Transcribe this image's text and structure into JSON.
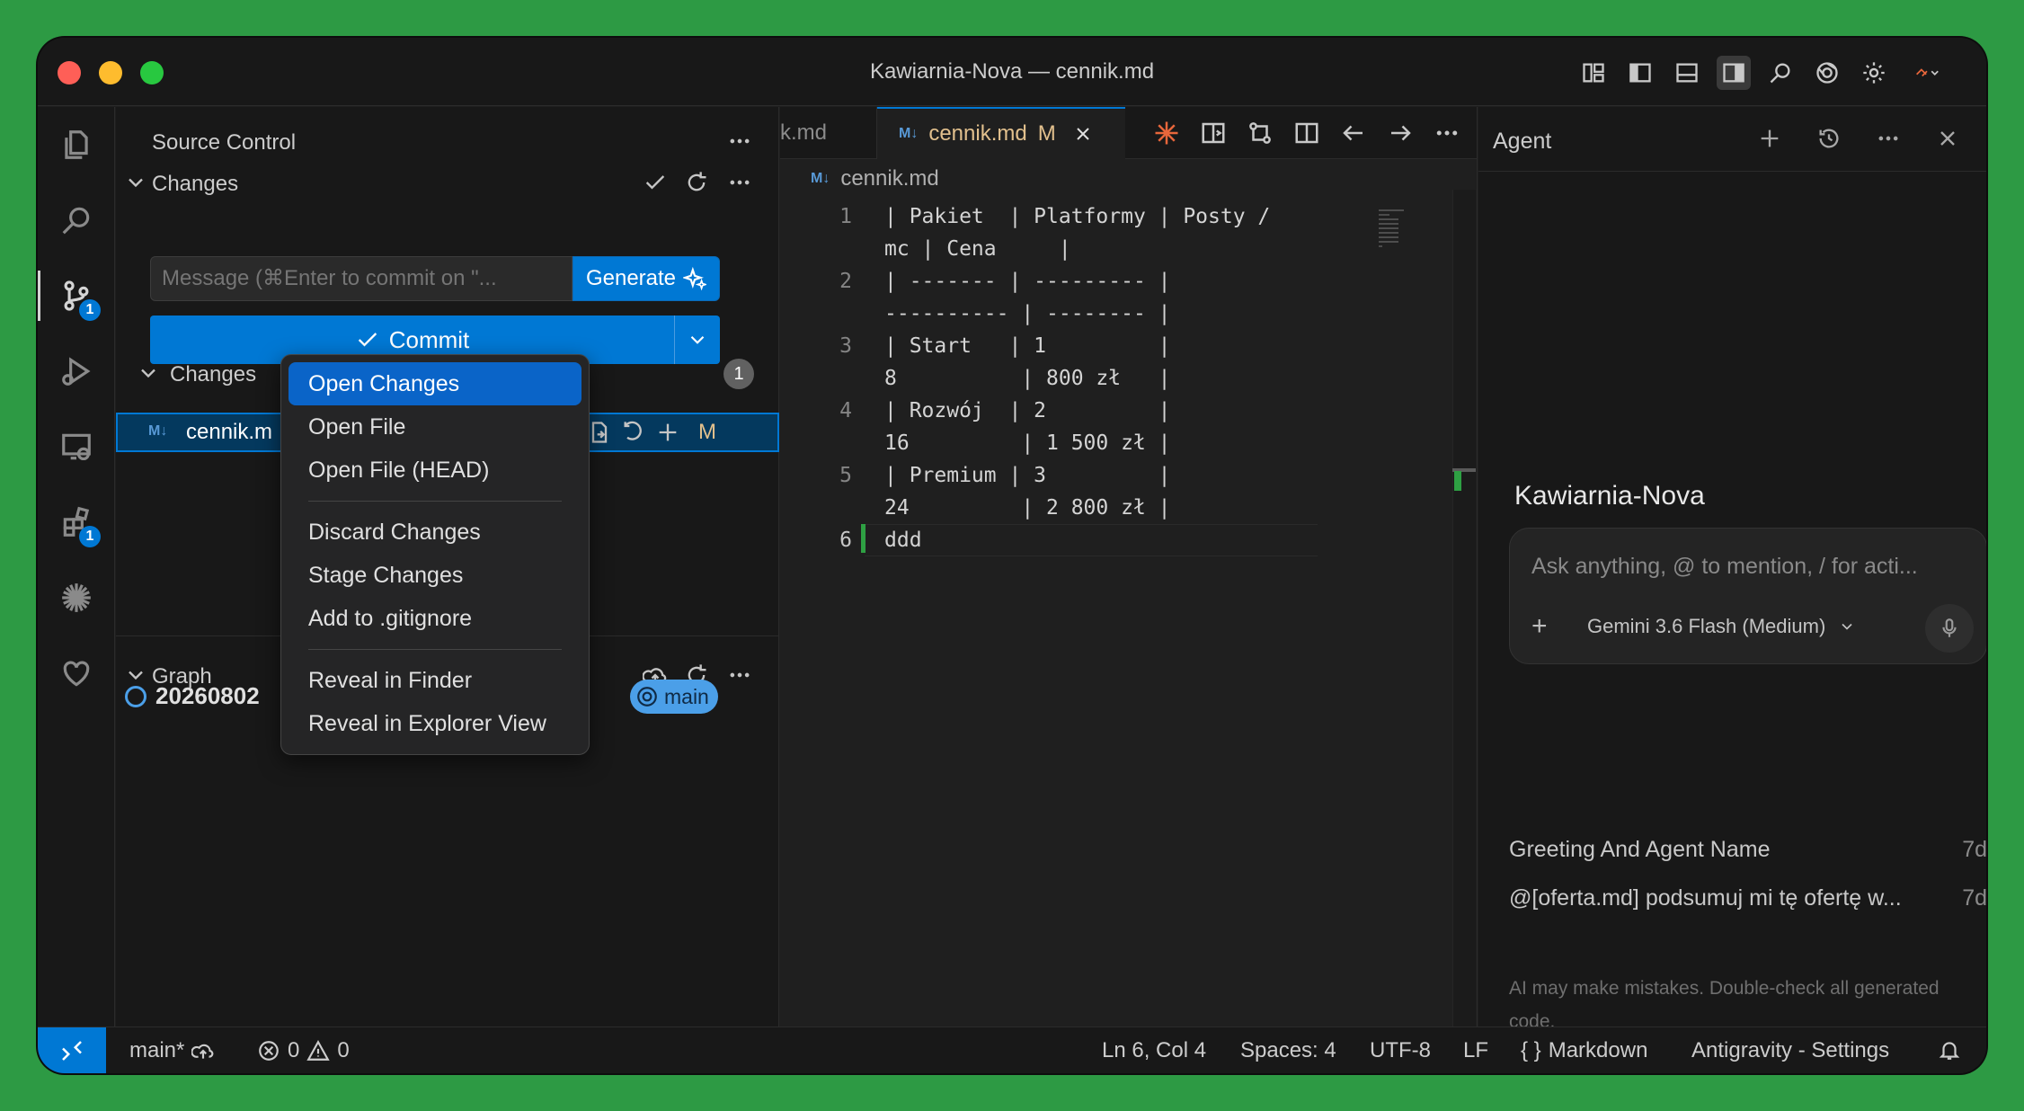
{
  "window": {
    "title": "Kawiarnia-Nova — cennik.md"
  },
  "activity_bar": {
    "items": [
      {
        "name": "explorer",
        "icon": "files-icon"
      },
      {
        "name": "search",
        "icon": "search-icon"
      },
      {
        "name": "source-control",
        "icon": "source-control-icon",
        "badge": "1"
      },
      {
        "name": "run-debug",
        "icon": "run-debug-icon"
      },
      {
        "name": "remote-explorer",
        "icon": "remote-explorer-icon"
      },
      {
        "name": "extensions",
        "icon": "extensions-icon",
        "badge": "1"
      },
      {
        "name": "antigravity",
        "icon": "sparkle-icon"
      },
      {
        "name": "sponsor",
        "icon": "heart-icon"
      }
    ]
  },
  "sidebar": {
    "title": "Source Control",
    "changes_header": "Changes",
    "message_placeholder": "Message (⌘Enter to commit on \"...",
    "generate_label": "Generate",
    "commit_label": "Commit",
    "changes_group": "Changes",
    "changes_count": "1",
    "file": {
      "name": "cennik.m",
      "icon": "markdown-icon",
      "status": "M"
    },
    "graph_header": "Graph",
    "graph_commit": "20260802",
    "branch_badge": "main"
  },
  "context_menu": {
    "items": [
      {
        "label": "Open Changes",
        "selected": true
      },
      {
        "label": "Open File"
      },
      {
        "label": "Open File (HEAD)"
      },
      {
        "separator": true
      },
      {
        "label": "Discard Changes"
      },
      {
        "label": "Stage Changes"
      },
      {
        "label": "Add to .gitignore"
      },
      {
        "separator": true
      },
      {
        "label": "Reveal in Finder"
      },
      {
        "label": "Reveal in Explorer View"
      }
    ]
  },
  "editor": {
    "prev_tab": "k.md",
    "active_tab": {
      "name": "cennik.md",
      "status": "M"
    },
    "breadcrumb": "cennik.md",
    "lines": [
      {
        "num": "1",
        "visual": [
          "| Pakiet  | Platformy | Posty /",
          "mc | Cena     |"
        ]
      },
      {
        "num": "2",
        "visual": [
          "| ------- | --------- |",
          "---------- | -------- |"
        ]
      },
      {
        "num": "3",
        "visual": [
          "| Start   | 1         |",
          "8          | 800 zł   |"
        ]
      },
      {
        "num": "4",
        "visual": [
          "| Rozwój  | 2         |",
          "16         | 1 500 zł |"
        ]
      },
      {
        "num": "5",
        "visual": [
          "| Premium | 3         |",
          "24         | 2 800 zł |"
        ]
      },
      {
        "num": "6",
        "visual": [
          "ddd"
        ]
      }
    ]
  },
  "agent": {
    "title": "Agent",
    "workspace": "Kawiarnia-Nova",
    "input_placeholder": "Ask anything, @ to mention, / for acti...",
    "model": "Gemini 3.6 Flash (Medium)",
    "history": [
      {
        "title": "Greeting And Agent Name",
        "time": "7d"
      },
      {
        "title": "@[oferta.md] podsumuj mi tę ofertę w...",
        "time": "7d"
      }
    ],
    "disclaimer": "AI may make mistakes. Double-check all generated code."
  },
  "status_bar": {
    "branch": "main*",
    "errors": "0",
    "warnings": "0",
    "position": "Ln 6, Col 4",
    "spaces": "Spaces: 4",
    "encoding": "UTF-8",
    "eol": "LF",
    "language": "Markdown",
    "settings": "Antigravity - Settings"
  },
  "colors": {
    "accent": "#0078d4",
    "modified_tab": "#e2c08d",
    "selection": "#04395e",
    "added_gutter": "#2ea043"
  }
}
